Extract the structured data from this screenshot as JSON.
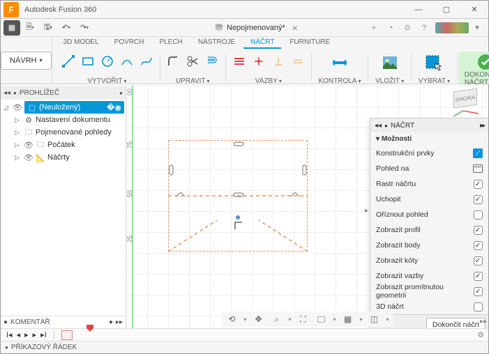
{
  "app": {
    "title": "Autodesk Fusion 360",
    "icon_letter": "F"
  },
  "document": {
    "name": "Nepojmenovaný*"
  },
  "workspace_tabs": [
    "3D MODEL",
    "POVRCH",
    "PLECH",
    "NÁSTROJE",
    "NÁČRT",
    "FURNITURE"
  ],
  "active_ws_tab": 4,
  "navrh_label": "NÁVRH",
  "groups": {
    "create": "VYTVOŘIT",
    "modify": "UPRAVIT",
    "constraints": "VAZBY",
    "inspect": "KONTROLA",
    "insert": "VLOŽIT",
    "select": "VYBRAT",
    "finish": "DOKONČIT NÁČRT"
  },
  "browser": {
    "header": "PROHLÍŽEČ",
    "root": "(Neuložený)",
    "items": [
      "Nastavení dokumentu",
      "Pojmenované pohledy",
      "Počátek",
      "Náčrty"
    ]
  },
  "comments_header": "KOMENTÁŘ",
  "ruler_ticks": [
    "00",
    "75",
    "50",
    "25"
  ],
  "view_cube_face": "SHORA",
  "sketch_panel": {
    "title": "NÁČRT",
    "section": "Možnosti",
    "rows": [
      {
        "label": "Konstrukční prvky",
        "type": "blue"
      },
      {
        "label": "Pohled na",
        "type": "cal"
      },
      {
        "label": "Rastr náčrtu",
        "type": "check",
        "checked": true
      },
      {
        "label": "Uchopit",
        "type": "check",
        "checked": true
      },
      {
        "label": "Oříznout pohled",
        "type": "check",
        "checked": false
      },
      {
        "label": "Zobrazit profil",
        "type": "check",
        "checked": true
      },
      {
        "label": "Zobrazit body",
        "type": "check",
        "checked": true
      },
      {
        "label": "Zobrazit kóty",
        "type": "check",
        "checked": true
      },
      {
        "label": "Zobrazit vazby",
        "type": "check",
        "checked": true
      },
      {
        "label": "Zobrazit promítnutou geometrii",
        "type": "check",
        "checked": true
      },
      {
        "label": "3D náčrt",
        "type": "check",
        "checked": false
      }
    ],
    "finish_btn": "Dokončit náčrt"
  },
  "cmdline": "PŘÍKAZOVÝ ŘÁDEK"
}
